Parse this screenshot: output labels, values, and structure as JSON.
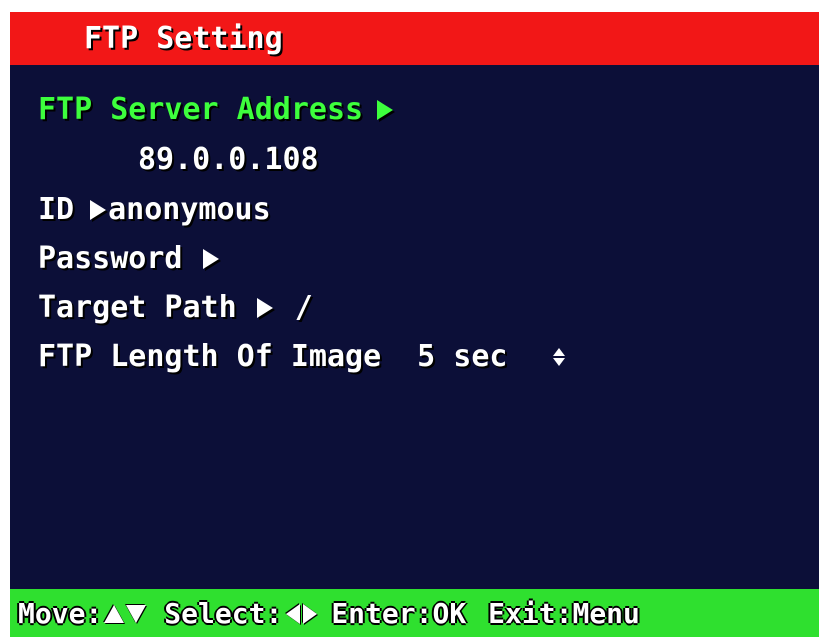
{
  "header": {
    "title": "FTP Setting"
  },
  "menu": {
    "server_address": {
      "label": "FTP Server Address",
      "value": "89.0.0.108"
    },
    "id": {
      "label": "ID",
      "value": "anonymous"
    },
    "password": {
      "label": "Password",
      "value": ""
    },
    "target_path": {
      "label": "Target Path",
      "value": "/"
    },
    "length_of_image": {
      "label": "FTP Length Of Image",
      "value": "5 sec"
    }
  },
  "footer": {
    "move_label": "Move:",
    "select_label": "Select:",
    "enter_label": "Enter:OK",
    "exit_label": "Exit:Menu"
  },
  "colors": {
    "title_bar": "#f21717",
    "background": "#0c0f38",
    "selected_text": "#3dff3d",
    "status_bar": "#2fe02f",
    "text": "#ffffff"
  },
  "icons": {
    "submenu_arrow": "right-triangle-icon",
    "value_adjust": "up-down-arrows-icon",
    "move": "up-down-triangles-icon",
    "select": "left-right-triangles-icon"
  }
}
